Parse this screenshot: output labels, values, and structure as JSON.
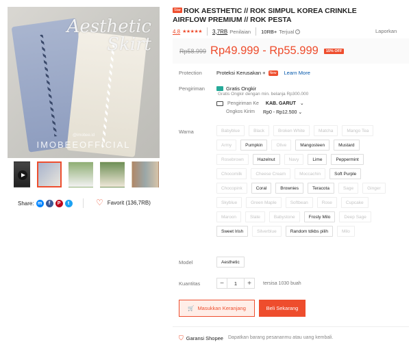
{
  "gallery": {
    "overlay_title_line1": "Aesthetic",
    "overlay_title_line2": "Skirt",
    "overlay_small": "@imobee.id",
    "overlay_shop": "IMOBEEOFFICIAL"
  },
  "share": {
    "label": "Share:"
  },
  "favorite": {
    "label": "Favorit (136,7RB)"
  },
  "product": {
    "badge": "Star",
    "title": "ROK AESTHETIC // ROK SIMPUL KOREA CRINKLE AIRFLOW PREMIUM // ROK PESTA",
    "rating": "4.8",
    "stars": "★★★★★",
    "ratings_count": "3,7RB",
    "ratings_label": "Penilaian",
    "sold_count": "10RB+",
    "sold_label": "Terjual",
    "report": "Laporkan"
  },
  "price": {
    "original": "Rp58.999",
    "current": "Rp49.999 - Rp55.999",
    "discount": "15% OFF"
  },
  "protection": {
    "label": "Protection",
    "value": "Proteksi Kerusakan +",
    "new_badge": "New",
    "learn_more": "Learn More"
  },
  "shipping": {
    "label": "Pengiriman",
    "free_title": "Gratis Ongkir",
    "free_sub": "Gratis Ongkir dengan min. belanja Rp300.000",
    "to_label": "Pengiriman Ke",
    "to_value": "KAB. GARUT",
    "cost_label": "Ongkos Kirim",
    "cost_value": "Rp0 - Rp12.500"
  },
  "variants": {
    "label": "Warna",
    "options": [
      {
        "name": "Babyblue",
        "disabled": true
      },
      {
        "name": "Black",
        "disabled": true
      },
      {
        "name": "Broken White",
        "disabled": true
      },
      {
        "name": "Matcha",
        "disabled": true
      },
      {
        "name": "Mango Tea",
        "disabled": true
      },
      {
        "name": "Army",
        "disabled": true
      },
      {
        "name": "Pumpkin",
        "disabled": false
      },
      {
        "name": "Olive",
        "disabled": true
      },
      {
        "name": "Mangosteen",
        "disabled": false
      },
      {
        "name": "Mustard",
        "disabled": false
      },
      {
        "name": "Rosebrown",
        "disabled": true
      },
      {
        "name": "Hazelnut",
        "disabled": false
      },
      {
        "name": "Navy",
        "disabled": true
      },
      {
        "name": "Lime",
        "disabled": false
      },
      {
        "name": "Peppermint",
        "disabled": false
      },
      {
        "name": "Chocomilk",
        "disabled": true
      },
      {
        "name": "Cheese Cream",
        "disabled": true
      },
      {
        "name": "Moccachin",
        "disabled": true
      },
      {
        "name": "Soft Purple",
        "disabled": false
      },
      {
        "name": "Chocopink",
        "disabled": true
      },
      {
        "name": "Coral",
        "disabled": false
      },
      {
        "name": "Brownies",
        "disabled": false
      },
      {
        "name": "Teracota",
        "disabled": false
      },
      {
        "name": "Sage",
        "disabled": true
      },
      {
        "name": "Ginger",
        "disabled": true
      },
      {
        "name": "Skyblue",
        "disabled": true
      },
      {
        "name": "Green Maple",
        "disabled": true
      },
      {
        "name": "Softbean",
        "disabled": true
      },
      {
        "name": "Rose",
        "disabled": true
      },
      {
        "name": "Cupcake",
        "disabled": true
      },
      {
        "name": "Maroon",
        "disabled": true
      },
      {
        "name": "Slate",
        "disabled": true
      },
      {
        "name": "Babystone",
        "disabled": true
      },
      {
        "name": "Frosty Milo",
        "disabled": false
      },
      {
        "name": "Deep Sage",
        "disabled": true
      },
      {
        "name": "Sweet Irish",
        "disabled": false
      },
      {
        "name": "Silverblue",
        "disabled": true
      },
      {
        "name": "Random tdkbs pilih",
        "disabled": false
      },
      {
        "name": "Milo",
        "disabled": true
      }
    ]
  },
  "model": {
    "label": "Model",
    "value": "Aesthetic"
  },
  "quantity": {
    "label": "Kuantitas",
    "minus": "−",
    "value": "1",
    "plus": "+",
    "stock": "tersisa 1030 buah"
  },
  "actions": {
    "cart": "Masukkan Keranjang",
    "buy": "Beli Sekarang"
  },
  "guarantee": {
    "title": "Garansi Shopee",
    "sub": "Dapatkan barang pesananmu atau uang kembali."
  },
  "colors": {
    "accent": "#ee4d2d",
    "link": "#0055aa",
    "teal": "#26aa99"
  }
}
